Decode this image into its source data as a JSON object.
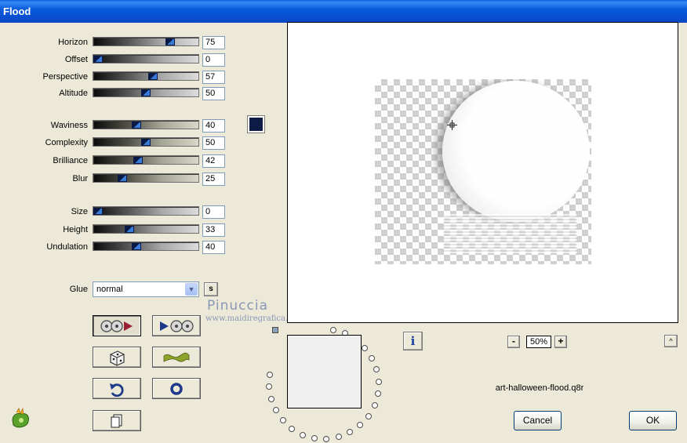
{
  "window": {
    "title": "Flood"
  },
  "params": [
    {
      "id": "horizon",
      "label": "Horizon",
      "value": "75",
      "track": "gray"
    },
    {
      "id": "offset",
      "label": "Offset",
      "value": "0",
      "track": "gray"
    },
    {
      "id": "perspective",
      "label": "Perspective",
      "value": "57",
      "track": "gray"
    },
    {
      "id": "altitude",
      "label": "Altitude",
      "value": "50",
      "track": "gray"
    },
    {
      "id": "waviness",
      "label": "Waviness",
      "value": "40",
      "track": "beige"
    },
    {
      "id": "complexity",
      "label": "Complexity",
      "value": "50",
      "track": "beige"
    },
    {
      "id": "brilliance",
      "label": "Brilliance",
      "value": "42",
      "track": "beige"
    },
    {
      "id": "blur",
      "label": "Blur",
      "value": "25",
      "track": "beige"
    },
    {
      "id": "size",
      "label": "Size",
      "value": "0",
      "track": "gray"
    },
    {
      "id": "height",
      "label": "Height",
      "value": "33",
      "track": "gray"
    },
    {
      "id": "undulation",
      "label": "Undulation",
      "value": "40",
      "track": "gray"
    }
  ],
  "color": {
    "swatch": "#0c1c46"
  },
  "glue": {
    "label": "Glue",
    "value": "normal",
    "s_button": "s"
  },
  "watermark": {
    "line1": "Pinuccia",
    "line2": "www.maidiregrafica.eu"
  },
  "toolbar": {
    "buttons": [
      {
        "id": "preset-apply",
        "icon": "film-reel-to-arrow-icon"
      },
      {
        "id": "preset-load",
        "icon": "arrow-to-film-reel-icon"
      },
      {
        "id": "random",
        "icon": "dice-icon"
      },
      {
        "id": "wave-preset",
        "icon": "wave-icon"
      },
      {
        "id": "undo",
        "icon": "undo-arrow-icon"
      },
      {
        "id": "reset",
        "icon": "ring-icon"
      },
      {
        "id": "copy",
        "icon": "document-copy-icon"
      }
    ]
  },
  "preview": {
    "zoom": "50%",
    "filename": "art-halloween-flood.q8r",
    "zoom_out": "-",
    "zoom_in": "+",
    "collapse": "^"
  },
  "info": {
    "label": "i"
  },
  "actions": {
    "cancel": "Cancel",
    "ok": "OK"
  }
}
